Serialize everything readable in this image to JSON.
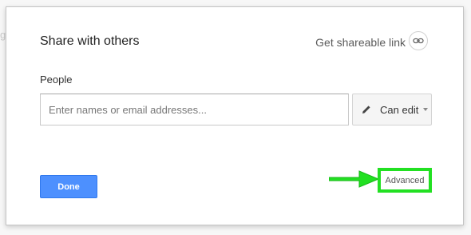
{
  "background": {
    "ghost_text": "gr"
  },
  "dialog": {
    "title": "Share with others",
    "shareable_link_label": "Get shareable link",
    "shareable_link_icon": "link-icon",
    "people_label": "People",
    "people_input": {
      "placeholder": "Enter names or email addresses...",
      "value": ""
    },
    "permission": {
      "label": "Can edit",
      "icon": "pencil-icon",
      "caret": "chevron-down-icon"
    },
    "done_label": "Done",
    "advanced_label": "Advanced"
  },
  "annotation": {
    "arrow_color": "#22e022",
    "highlight_color": "#22e022"
  },
  "colors": {
    "primary_button": "#4d90fe"
  }
}
